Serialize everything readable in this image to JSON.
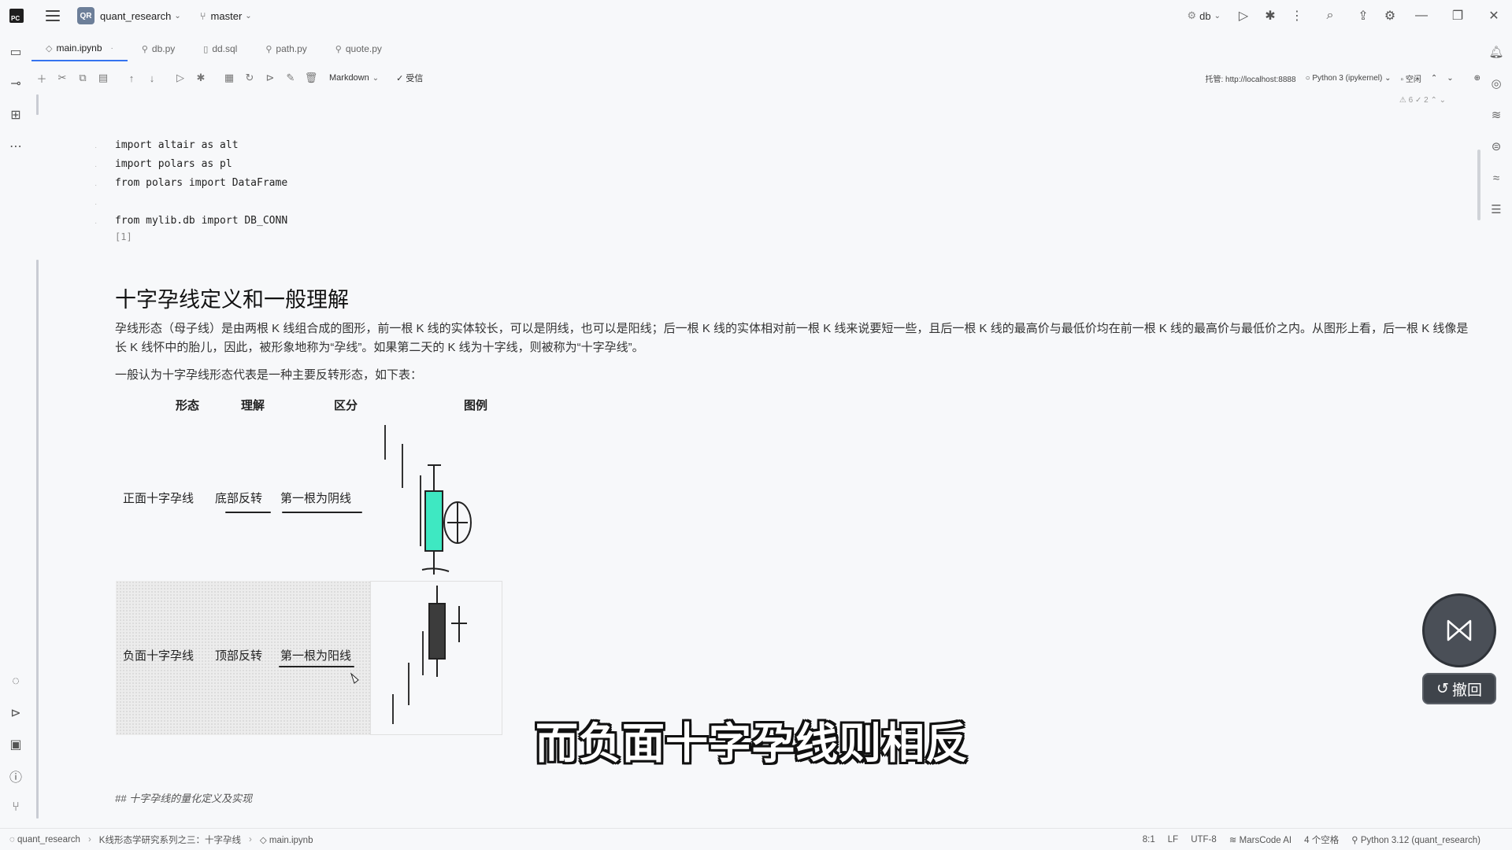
{
  "titlebar": {
    "project_badge": "QR",
    "project": "quant_research",
    "branch": "master",
    "run_config": "db"
  },
  "tabs": [
    {
      "label": "main.ipynb",
      "active": true
    },
    {
      "label": "db.py"
    },
    {
      "label": "dd.sql"
    },
    {
      "label": "path.py"
    },
    {
      "label": "quote.py"
    }
  ],
  "nb_toolbar": {
    "cell_type": "Markdown",
    "trusted": "受信",
    "server": "托管: http://localhost:8888",
    "kernel": "Python 3 (ipykernel)",
    "kernel_status": "空闲",
    "warnings": "6",
    "checks": "2"
  },
  "code_cell": {
    "lines": [
      "import altair as alt",
      "import polars as pl",
      "from polars import DataFrame",
      "",
      "from mylib.db import DB_CONN"
    ],
    "exec_count": "[1]"
  },
  "markdown": {
    "title": "十字孕线定义和一般理解",
    "para1": "孕线形态（母子线）是由两根 K 线组合成的图形，前一根 K 线的实体较长，可以是阴线，也可以是阳线；后一根 K 线的实体相对前一根 K 线来说要短一些，且后一根 K 线的最高价与最低价均在前一根 K 线的最高价与最低价之内。从图形上看，后一根 K 线像是长 K 线怀中的胎儿，因此，被形象地称为“孕线”。如果第二天的 K 线为十字线，则被称为“十字孕线”。",
    "para2": "一般认为十字孕线形态代表是一种主要反转形态，如下表：",
    "table": {
      "headers": [
        "形态",
        "理解",
        "区分",
        "图例"
      ],
      "rows": [
        {
          "form": "正面十字孕线",
          "meaning": "底部反转",
          "diff": "第一根为阴线"
        },
        {
          "form": "负面十字孕线",
          "meaning": "顶部反转",
          "diff": "第一根为阳线"
        }
      ]
    },
    "footer_line": "## 十字孕线的量化定义及实现"
  },
  "colors": {
    "bull_candle": "#3ee8c2",
    "bear_candle": "#3c3c3c",
    "accent": "#3574f0"
  },
  "overlay": {
    "subtitle": "而负面十字孕线则相反",
    "undo_label": "撤回"
  },
  "statusbar": {
    "project": "quant_research",
    "folder": "K线形态学研究系列之三：十字孕线",
    "file": "main.ipynb",
    "position": "8:1",
    "line_sep": "LF",
    "encoding": "UTF-8",
    "assistant": "MarsCode AI",
    "indent": "4 个空格",
    "interpreter": "Python 3.12 (quant_research)"
  }
}
